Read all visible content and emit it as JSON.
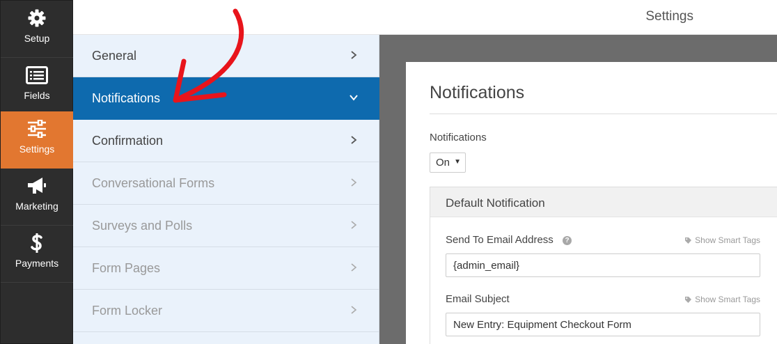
{
  "nav": {
    "items": [
      {
        "label": "Setup",
        "icon": "gear-icon"
      },
      {
        "label": "Fields",
        "icon": "fields-icon"
      },
      {
        "label": "Settings",
        "icon": "sliders-icon",
        "active": true
      },
      {
        "label": "Marketing",
        "icon": "megaphone-icon"
      },
      {
        "label": "Payments",
        "icon": "dollar-icon"
      }
    ]
  },
  "header": {
    "title": "Settings"
  },
  "settings_panels": [
    {
      "label": "General"
    },
    {
      "label": "Notifications",
      "active": true
    },
    {
      "label": "Confirmation"
    },
    {
      "label": "Conversational Forms",
      "muted": true
    },
    {
      "label": "Surveys and Polls",
      "muted": true
    },
    {
      "label": "Form Pages",
      "muted": true
    },
    {
      "label": "Form Locker",
      "muted": true
    }
  ],
  "notifications": {
    "title": "Notifications",
    "toggle_label": "Notifications",
    "toggle_value": "On",
    "default_notification": {
      "title": "Default Notification",
      "send_to_label": "Send To Email Address",
      "send_to_value": "{admin_email}",
      "smart_tags_label": "Show Smart Tags",
      "subject_label": "Email Subject",
      "subject_value": "New Entry: Equipment Checkout Form"
    }
  },
  "colors": {
    "nav_bg": "#2d2d2d",
    "nav_active": "#e27730",
    "panel_active": "#0e6aae",
    "panel_bg": "#eaf2fb",
    "annotation_arrow": "#e8141b"
  }
}
